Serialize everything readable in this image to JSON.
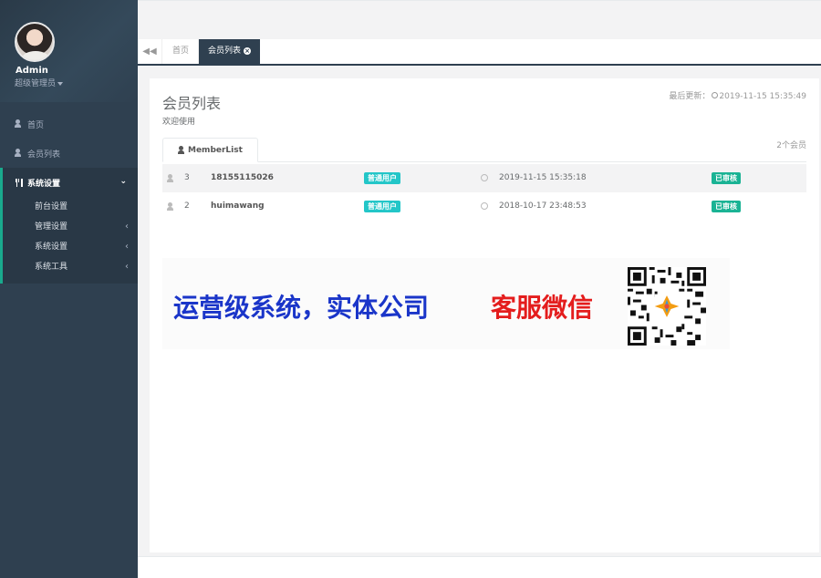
{
  "profile": {
    "name": "Admin",
    "role": "超级管理员"
  },
  "nav": {
    "home": "首页",
    "members": "会员列表",
    "system": "系统设置",
    "subitems": [
      "前台设置",
      "管理设置",
      "系统设置",
      "系统工具"
    ]
  },
  "tabs": {
    "home": "首页",
    "active": "会员列表"
  },
  "page": {
    "title": "会员列表",
    "subtitle": "欢迎使用",
    "last_update_label": "最后更新：",
    "last_update_time": "2019-11-15 15:35:49",
    "member_count": "2个会员",
    "list_tab": "MemberList"
  },
  "members": [
    {
      "id": "3",
      "name": "18155115026",
      "type": "普通用户",
      "time": "2019-11-15 15:35:18",
      "status": "已审核"
    },
    {
      "id": "2",
      "name": "huimawang",
      "type": "普通用户",
      "time": "2018-10-17 23:48:53",
      "status": "已审核"
    }
  ],
  "ad": {
    "blue_text": "运营级系统，实体公司",
    "red_text": "客服微信"
  },
  "colors": {
    "sidebar_bg": "#2f4050",
    "accent": "#1ab394",
    "info": "#23c6c8",
    "ad_blue": "#1a35c9",
    "ad_red": "#e41d1d"
  }
}
